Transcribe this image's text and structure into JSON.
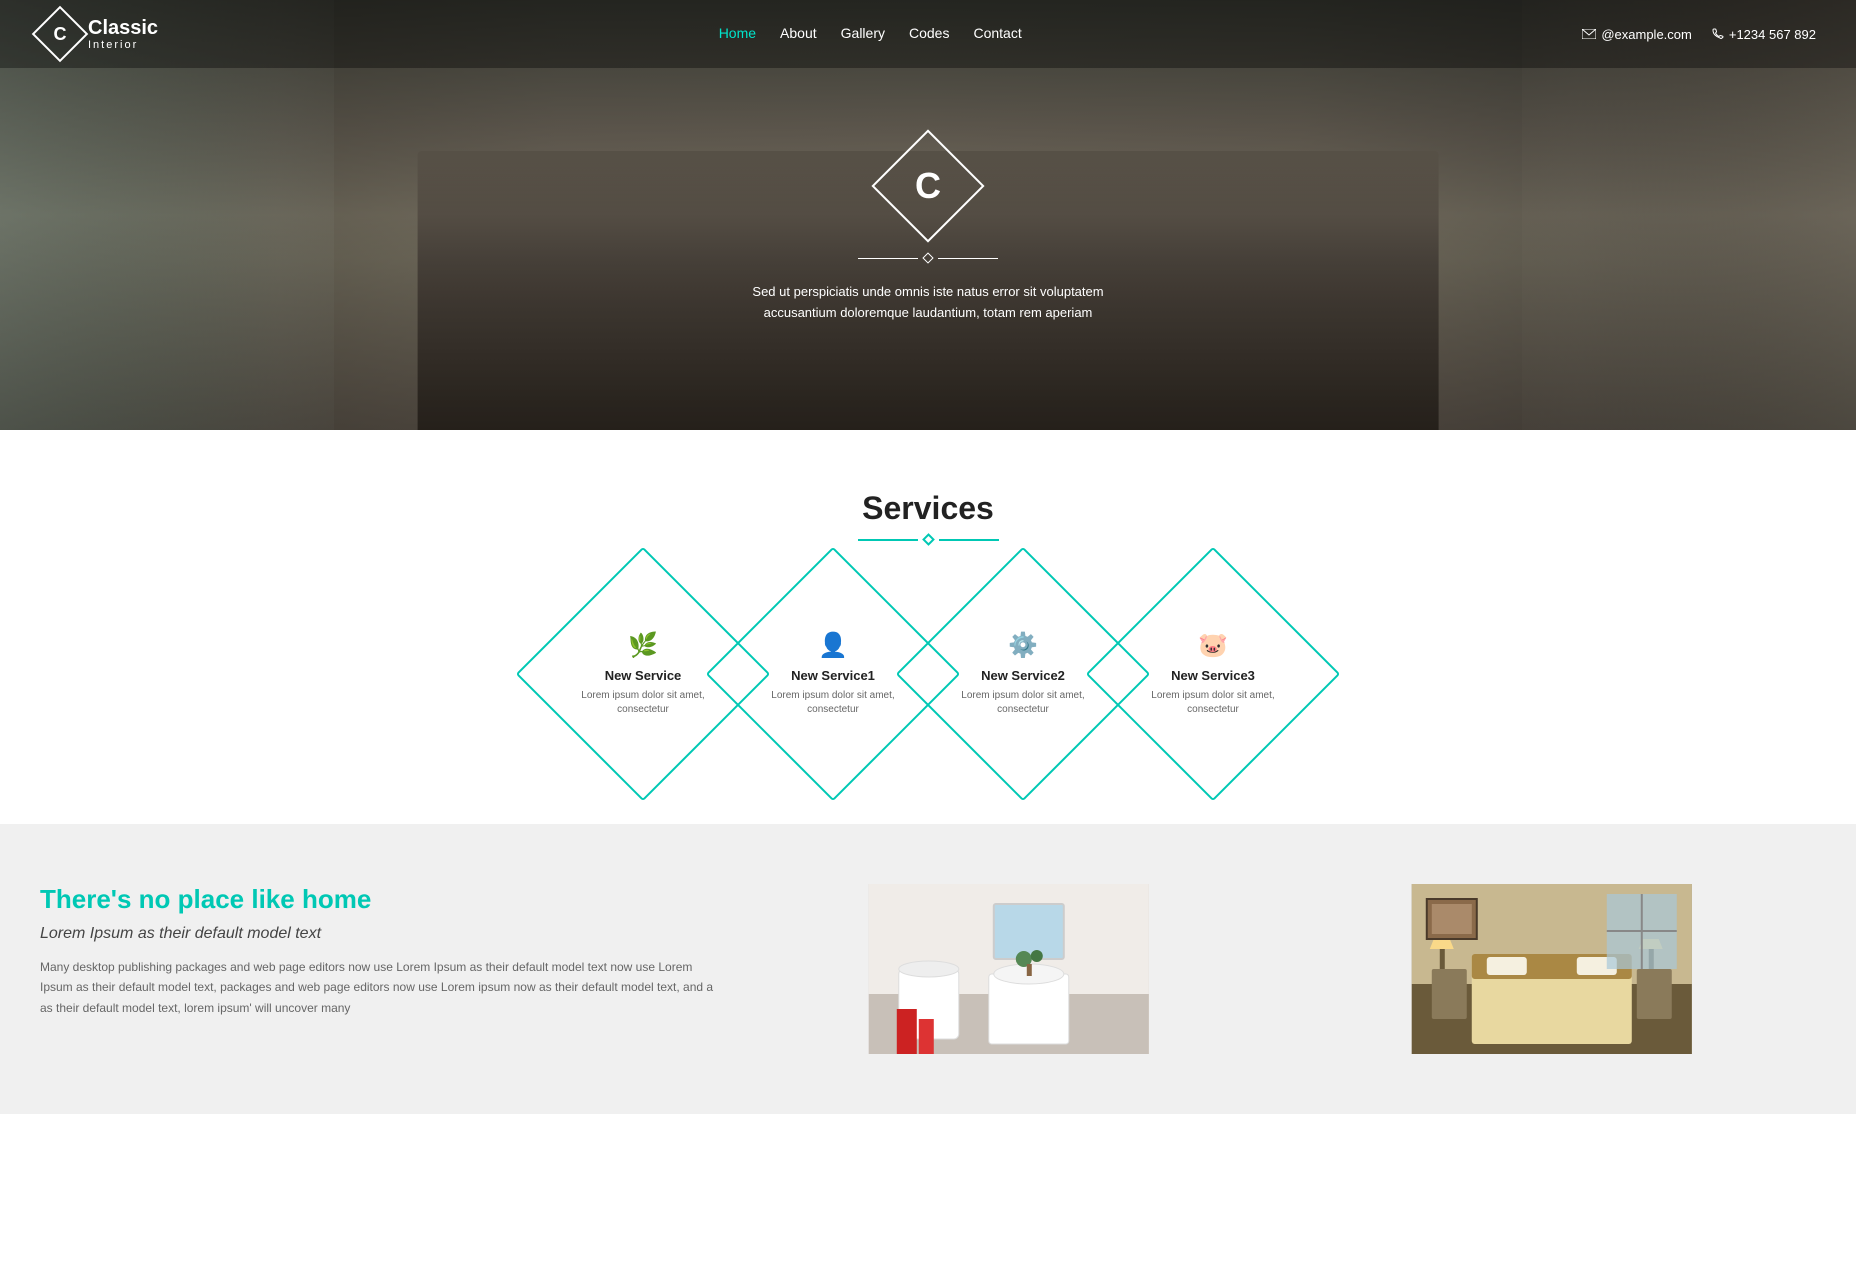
{
  "brand": {
    "letter": "C",
    "name": "lassic",
    "subtitle": "Interior"
  },
  "navbar": {
    "links": [
      {
        "label": "Home",
        "active": true
      },
      {
        "label": "About",
        "active": false
      },
      {
        "label": "Gallery",
        "active": false
      },
      {
        "label": "Codes",
        "active": false
      },
      {
        "label": "Contact",
        "active": false
      }
    ],
    "email": "@example.com",
    "phone": "+1234 567 892"
  },
  "hero": {
    "tagline": "Sed ut perspiciatis unde omnis iste natus error sit voluptatem accusantium doloremque laudantium, totam rem aperiam"
  },
  "services": {
    "title": "Services",
    "items": [
      {
        "icon": "🌿",
        "name": "New Service",
        "desc": "Lorem ipsum dolor sit amet, consectetur"
      },
      {
        "icon": "👤",
        "name": "New Service1",
        "desc": "Lorem ipsum dolor sit amet, consectetur"
      },
      {
        "icon": "⚙️",
        "name": "New Service2",
        "desc": "Lorem ipsum dolor sit amet, consectetur"
      },
      {
        "icon": "🐷",
        "name": "New Service3",
        "desc": "Lorem ipsum dolor sit amet, consectetur"
      }
    ]
  },
  "home_section": {
    "title": "There's no place like home",
    "subtitle": "Lorem Ipsum as their default model text",
    "body": "Many desktop publishing packages and web page editors now use Lorem Ipsum as their default model text now use Lorem Ipsum as their default model text, packages and web page editors now use Lorem ipsum now as their default model text, and a as their default model text, lorem ipsum' will uncover many"
  }
}
